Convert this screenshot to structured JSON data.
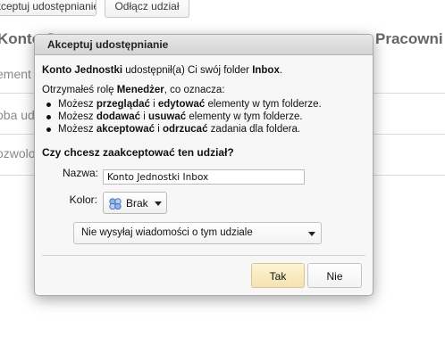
{
  "background": {
    "toolbar": {
      "accept_share_button": "Akceptuj udostępnianie",
      "detach_share_button": "Odłącz udział"
    },
    "title_left": "Konto Je",
    "title_right": "Pracowni",
    "row_labels": [
      "ement u",
      "oba ud",
      "ozwolo"
    ]
  },
  "dialog": {
    "title": "Akceptuj udostępnianie",
    "share_line": {
      "account": "Konto Jednostki",
      "text_middle": " udostępnił(a) Ci swój folder ",
      "folder": "Inbox",
      "text_end": "."
    },
    "role_line": {
      "prefix": "Otrzymałeś rolę ",
      "role": "Menedżer",
      "suffix": ", co oznacza:"
    },
    "permissions": [
      {
        "p1": "Możesz ",
        "b1": "przeglądać",
        "p2": " i ",
        "b2": "edytować",
        "p3": " elementy w tym folderze."
      },
      {
        "p1": "Możesz ",
        "b1": "dodawać",
        "p2": " i ",
        "b2": "usuwać",
        "p3": " elementy w tym folderze."
      },
      {
        "p1": "Możesz ",
        "b1": "akceptować",
        "p2": " i ",
        "b2": "odrzucać",
        "p3": " zadania dla foldera."
      }
    ],
    "question": "Czy chcesz zaakceptować ten udział?",
    "name_label": "Nazwa:",
    "name_value": "Konto Jednostki Inbox",
    "color_label": "Kolor:",
    "color_value": "Brak",
    "color_icon": "color-circles-icon",
    "notify_value": "Nie wysyłaj wiadomości o tym udziale",
    "yes_button": "Tak",
    "no_button": "Nie"
  },
  "colors": {
    "accent_yes_button": "#f4e3b0",
    "dialog_background": "#f7f7f7",
    "titlebar": "#d3d3d3"
  }
}
